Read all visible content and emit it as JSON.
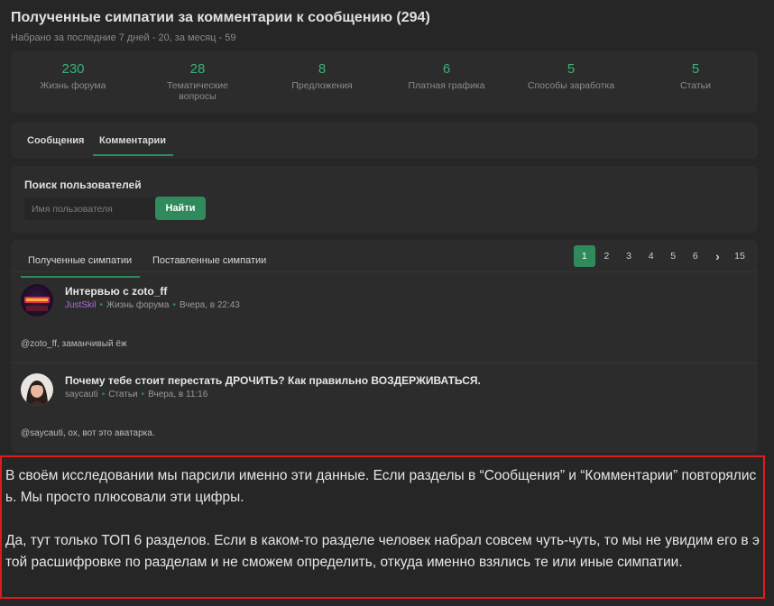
{
  "header": {
    "title": "Полученные симпатии за комментарии к сообщению (294)",
    "subtitle": "Набрано за последние 7 дней - 20, за месяц - 59"
  },
  "stats": [
    {
      "value": "230",
      "label": "Жизнь форума"
    },
    {
      "value": "28",
      "label": "Тематические вопросы"
    },
    {
      "value": "8",
      "label": "Предложения"
    },
    {
      "value": "6",
      "label": "Платная графика"
    },
    {
      "value": "5",
      "label": "Способы заработка"
    },
    {
      "value": "5",
      "label": "Статьи"
    }
  ],
  "main_tabs": [
    {
      "label": "Сообщения",
      "active": false
    },
    {
      "label": "Комментарии",
      "active": true
    }
  ],
  "search": {
    "label": "Поиск пользователей",
    "placeholder": "Имя пользователя",
    "button_label": "Найти"
  },
  "likes_tabs": [
    {
      "label": "Полученные симпатии",
      "active": true
    },
    {
      "label": "Поставленные симпатии",
      "active": false
    }
  ],
  "pagination": {
    "pages": [
      "1",
      "2",
      "3",
      "4",
      "5",
      "6"
    ],
    "active_page": "1",
    "next_icon": "chevron-right-icon",
    "last_page": "15"
  },
  "entries": [
    {
      "title": "Интервью с zoto_ff",
      "user": "JustSkil",
      "section": "Жизнь форума",
      "time": "Вчера, в 22:43",
      "text": "@zoto_ff, заманчивый ёж"
    },
    {
      "title": "Почему тебе стоит перестать ДРОЧИТЬ? Как правильно ВОЗДЕРЖИВАТЬСЯ.",
      "user": "saycauti",
      "section": "Статьи",
      "time": "Вчера, в 11:16",
      "text": "@saycauti, ох, вот это аватарка."
    }
  ],
  "note": {
    "paragraph1": "В своём исследовании мы парсили именно эти данные. Если разделы в “Сообщения” и “Комментарии” повторялись. Мы просто плюсовали эти цифры.",
    "paragraph2": "Да, тут только ТОП 6 разделов. Если в каком-то разделе человек набрал совсем чуть-чуть, то мы не увидим его в этой расшифровке по разделам и не сможем определить, откуда именно взялись те или иные симпатии."
  },
  "colors": {
    "accent": "#2f8a5c",
    "stat_value": "#3bb077",
    "highlight_border": "#e01b1b",
    "username_purple": "#a86ed9"
  }
}
